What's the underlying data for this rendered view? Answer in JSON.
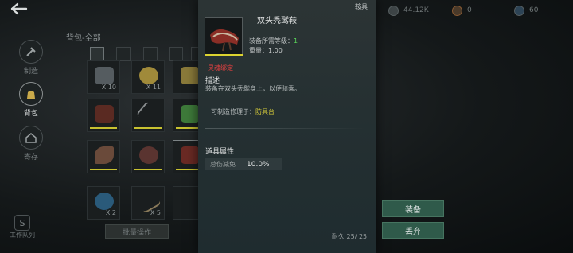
{
  "resources": [
    {
      "icon": "coin-icon",
      "value": "44.12K"
    },
    {
      "icon": "gem-icon",
      "value": "0"
    },
    {
      "icon": "crystal-icon",
      "value": "60"
    }
  ],
  "sidebar": {
    "items": [
      {
        "label": "制造",
        "icon": "hammer-icon"
      },
      {
        "label": "背包",
        "icon": "bag-icon"
      },
      {
        "label": "寄存",
        "icon": "house-icon"
      }
    ],
    "queue_label": "工作队列"
  },
  "inventory": {
    "title": "背包-全部",
    "slot_counts": [
      "X 10",
      "X 11",
      "X 2",
      "X 5"
    ],
    "batch_button": "批量操作"
  },
  "detail": {
    "category_tag": "鞍具",
    "name": "双头秃鹫鞍",
    "level_label": "装备所需等级：",
    "level_value": "1",
    "weight_label": "重量：",
    "weight_value": "1.00",
    "bound_label": "灵魂绑定",
    "desc_title": "描述",
    "desc_text": "装备在双头秃鹫身上，以便骑乘。",
    "repair_label": "可制造修理于：",
    "repair_value": "防具台",
    "attr_title": "道具属性",
    "attr_name": "总伤减免",
    "attr_value": "10.0%",
    "durability_label": "耐久",
    "durability_value": "25/ 25"
  },
  "actions": {
    "equip": "装备",
    "discard": "丢弃"
  },
  "colors": {
    "quality_yellow": "#dcd330",
    "bound_red": "#e04040",
    "button_green": "#2f5a4a"
  }
}
